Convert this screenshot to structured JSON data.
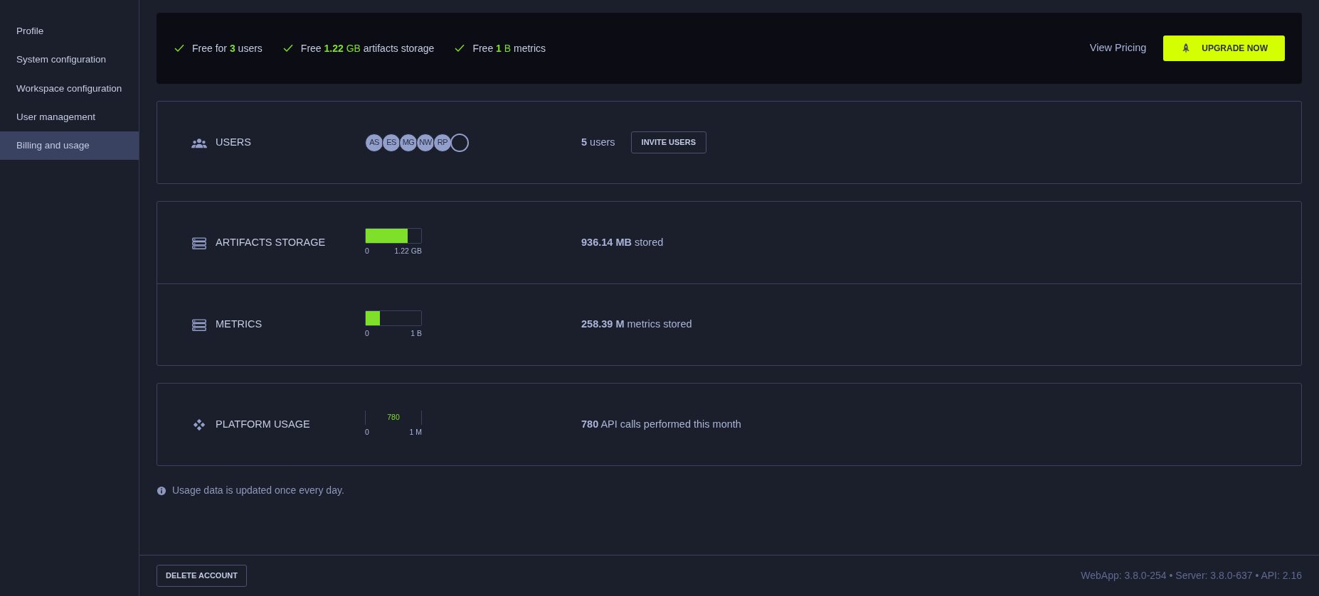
{
  "sidebar": {
    "items": [
      {
        "label": "Profile",
        "selected": false
      },
      {
        "label": "System configuration",
        "selected": false
      },
      {
        "label": "Workspace configuration",
        "selected": false
      },
      {
        "label": "User management",
        "selected": false
      },
      {
        "label": "Billing and usage",
        "selected": true
      }
    ]
  },
  "plan_banner": {
    "features": [
      {
        "before": "Free for ",
        "value": "3",
        "after": " users"
      },
      {
        "before": "Free ",
        "value": "1.22",
        "unit": " GB",
        "after": " artifacts storage"
      },
      {
        "before": "Free ",
        "value": "1",
        "unit": " B",
        "after": " metrics"
      }
    ],
    "pricing_link": "View Pricing",
    "upgrade_button": "UPGRADE NOW"
  },
  "users_card": {
    "label": "USERS",
    "avatars": [
      {
        "kind": "initials",
        "text": "AS"
      },
      {
        "kind": "initials",
        "text": "ES"
      },
      {
        "kind": "initials",
        "text": "MG"
      },
      {
        "kind": "initials",
        "text": "NW"
      },
      {
        "kind": "initials",
        "text": "RP"
      },
      {
        "kind": "empty"
      }
    ],
    "summary": "**5** users",
    "invite_button": "INVITE USERS"
  },
  "usage_cards": [
    {
      "rows": [
        {
          "kind": "bar",
          "label": "ARTIFACTS STORAGE",
          "level": 0.75,
          "min": "0",
          "max": "1.22 GB",
          "summary": "**936.14 MB** stored"
        },
        {
          "kind": "bar",
          "label": "METRICS",
          "level": 0.26,
          "min": "0",
          "max": "1 B",
          "summary": "**258.39 M** metrics stored"
        }
      ]
    },
    {
      "rows": [
        {
          "kind": "reading",
          "label": "PLATFORM USAGE",
          "reading": "780",
          "min": "0",
          "max": "1 M",
          "summary": "**780** API calls performed this month"
        }
      ]
    }
  ],
  "note": "Usage data is updated once every day.",
  "footer": {
    "delete_button": "DELETE ACCOUNT",
    "versions": "WebApp: 3.8.0-254 • Server: 3.8.0-637 • API: 2.16"
  }
}
